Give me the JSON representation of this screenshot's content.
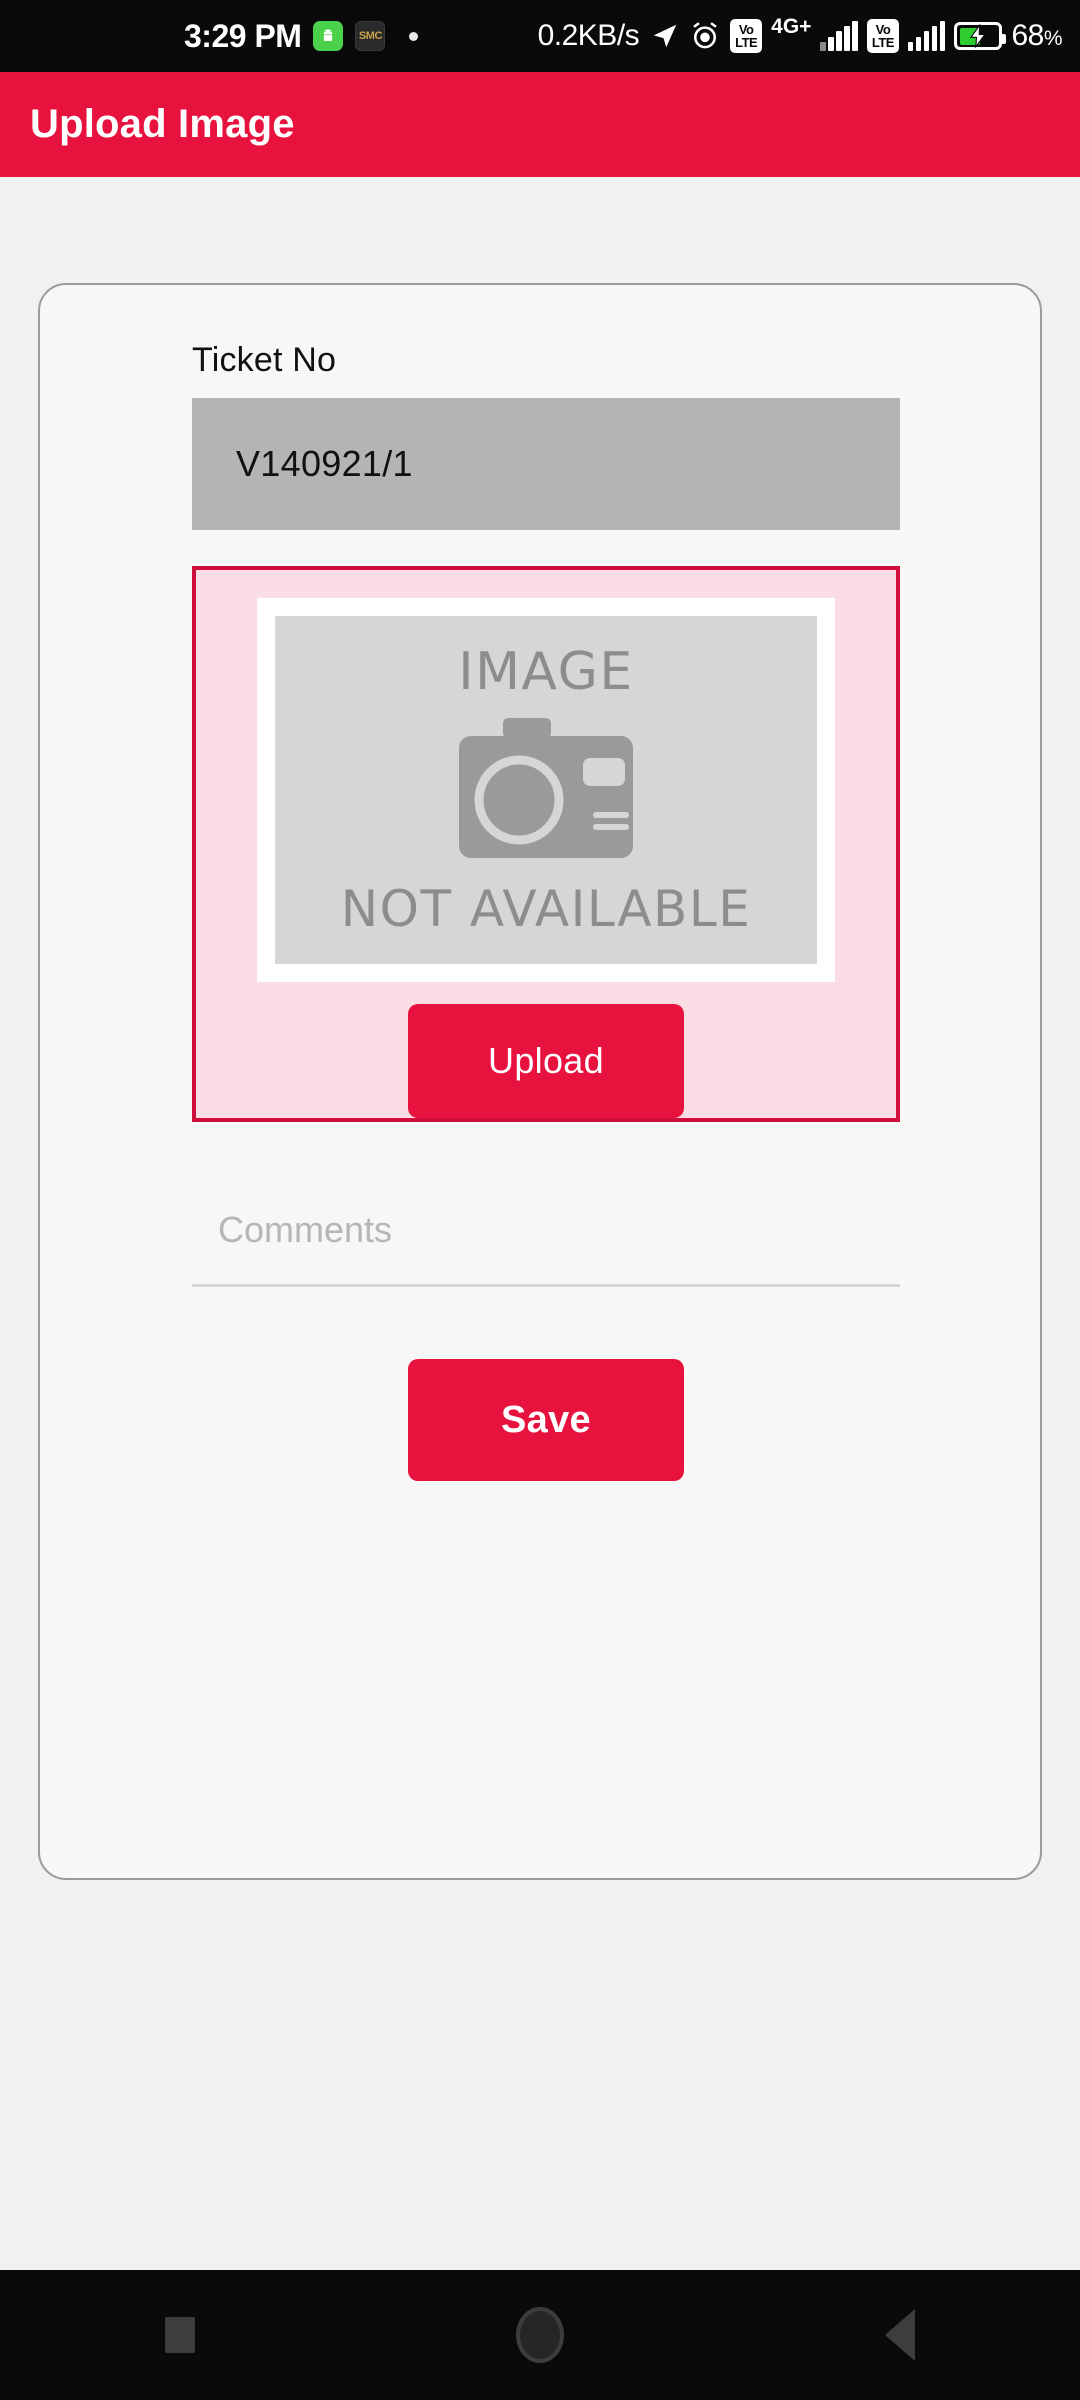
{
  "status_bar": {
    "time": "3:29 PM",
    "network_speed": "0.2KB/s",
    "battery_percent": "68",
    "battery_percent_symbol": "%",
    "network_label": "4G+",
    "volte_top": "Vo",
    "volte_bottom": "LTE",
    "smc_label": "SMC",
    "icons": [
      "android-app-icon",
      "smc-app-icon",
      "notification-dot",
      "location-arrow-icon",
      "alarm-clock-icon",
      "volte-icon",
      "signal-bars-icon",
      "battery-charging-icon"
    ]
  },
  "app_bar": {
    "title": "Upload Image",
    "background_color": "#e8123f",
    "text_color": "#ffffff"
  },
  "form": {
    "ticket": {
      "label": "Ticket No",
      "value": "V140921/1",
      "placeholder": "Ticket No"
    },
    "upload_area": {
      "placeholder_line1": "IMAGE",
      "placeholder_line2": "NOT AVAILABLE",
      "camera_icon": "camera-icon",
      "border_color": "#d10f3c",
      "background_color": "#fbdde6",
      "upload_button_label": "Upload"
    },
    "comments": {
      "value": "",
      "placeholder": "Comments"
    },
    "save_button_label": "Save"
  },
  "nav_bar": {
    "recents_label": "recents-button",
    "home_label": "home-button",
    "back_label": "back-button"
  },
  "theme": {
    "accent": "#e8123f",
    "accent_dark": "#d10f3c",
    "card_bg": "#f7f7f7",
    "page_bg": "#f1f1f1",
    "input_bg": "#b4b4b4"
  }
}
